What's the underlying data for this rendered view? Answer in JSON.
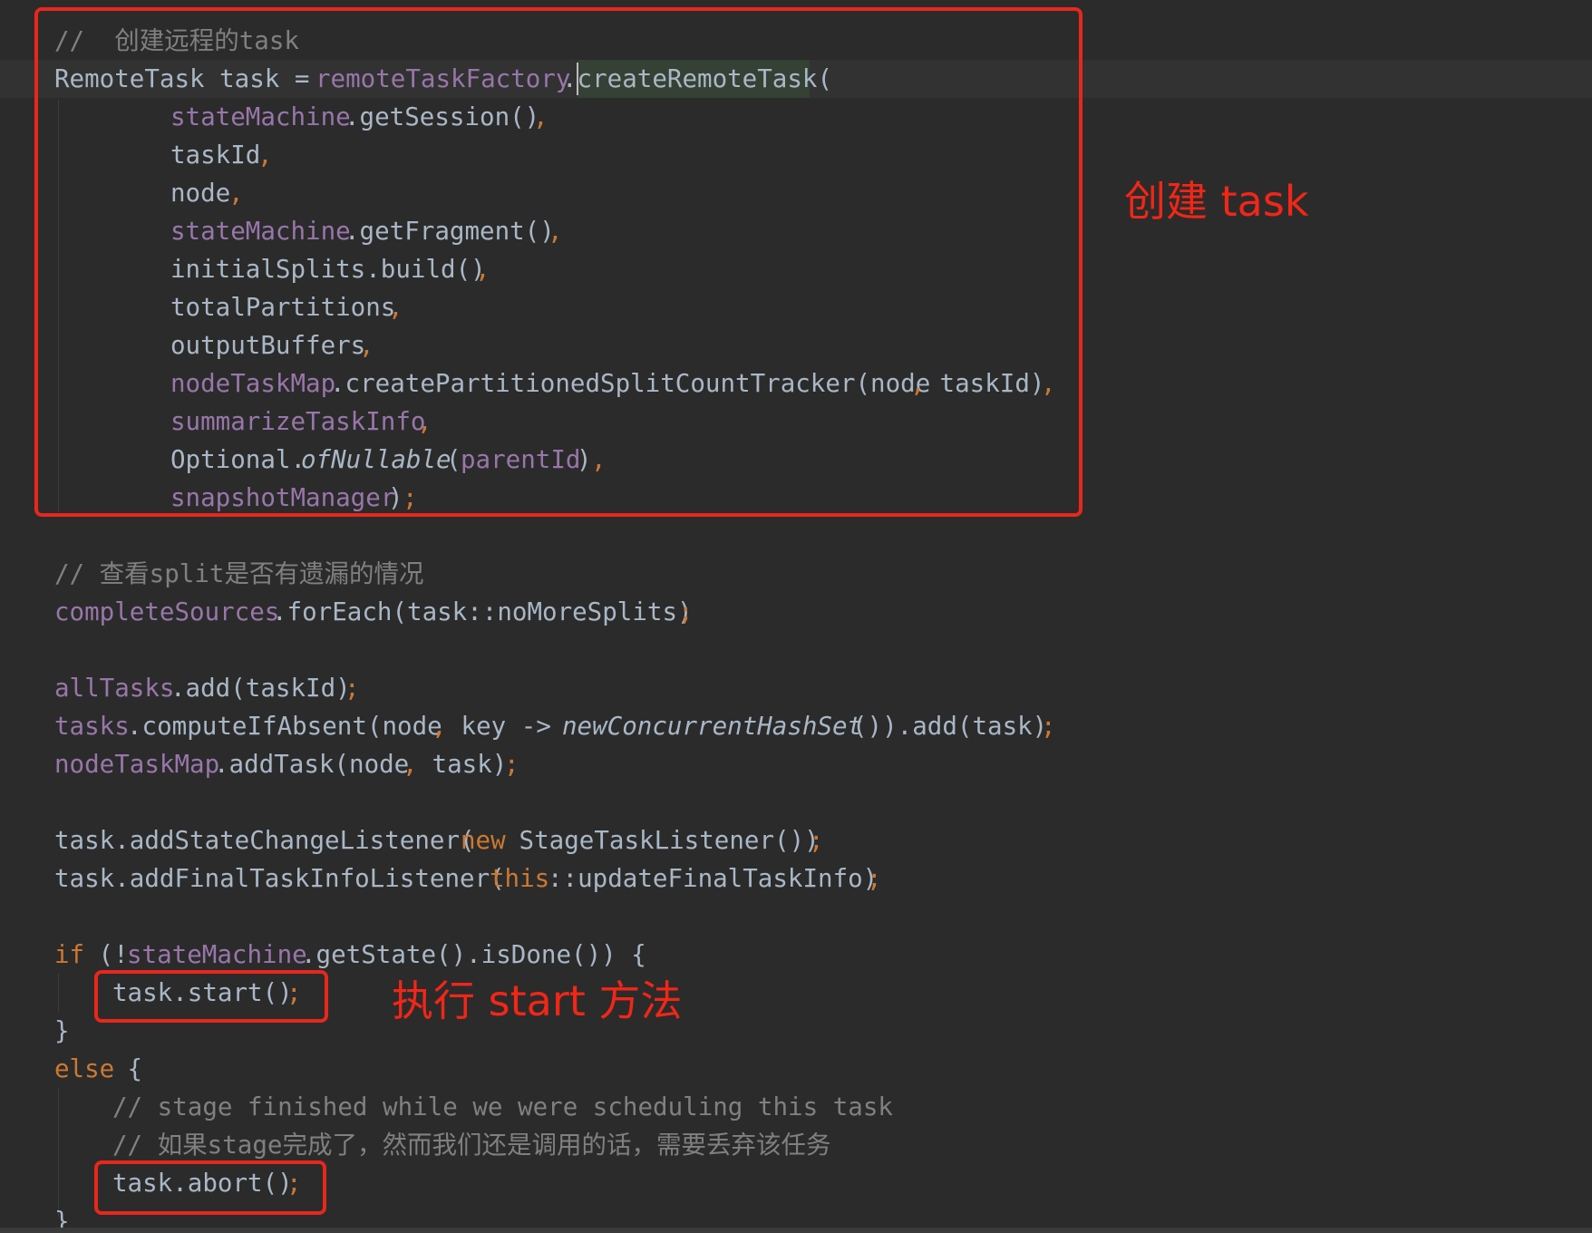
{
  "editor": {
    "theme_colors": {
      "background": "#2b2b2b",
      "default_text": "#a9b7c6",
      "field": "#9876aa",
      "keyword": "#cc7832",
      "comment": "#808080",
      "annotation_red": "#e8271c"
    },
    "lines": [
      {
        "segments": [
          "//  创建远程的task"
        ]
      },
      {
        "segments": [
          "RemoteTask task = ",
          "remoteTaskFactory",
          ".createRemoteTask("
        ]
      },
      {
        "segments": [
          "stateMachine",
          ".getSession()",
          ","
        ]
      },
      {
        "segments": [
          "taskId",
          ","
        ]
      },
      {
        "segments": [
          "node",
          ","
        ]
      },
      {
        "segments": [
          "stateMachine",
          ".getFragment()",
          ","
        ]
      },
      {
        "segments": [
          "initialSplits.build()",
          ","
        ]
      },
      {
        "segments": [
          "totalPartitions",
          ","
        ]
      },
      {
        "segments": [
          "outputBuffers",
          ","
        ]
      },
      {
        "segments": [
          "nodeTaskMap",
          ".createPartitionedSplitCountTracker(node",
          ",",
          " taskId)",
          ","
        ]
      },
      {
        "segments": [
          "summarizeTaskInfo",
          ","
        ]
      },
      {
        "segments": [
          "Optional.",
          "ofNullable",
          "(",
          "parentId",
          ")",
          ","
        ]
      },
      {
        "segments": [
          "snapshotManager",
          ")",
          ";"
        ]
      },
      {
        "segments": [
          "// 查看split是否有遗漏的情况"
        ]
      },
      {
        "segments": [
          "completeSources",
          ".forEach(task::noMoreSplits)",
          ";"
        ]
      },
      {
        "segments": [
          "allTasks",
          ".add(taskId)",
          ";"
        ]
      },
      {
        "segments": [
          "tasks",
          ".computeIfAbsent(node",
          ",",
          " key -> ",
          "newConcurrentHashSet",
          "()).add(task)",
          ";"
        ]
      },
      {
        "segments": [
          "nodeTaskMap",
          ".addTask(node",
          ",",
          " task)",
          ";"
        ]
      },
      {
        "segments": [
          "task.addStateChangeListener(",
          "new",
          " StageTaskListener())",
          ";"
        ]
      },
      {
        "segments": [
          "task.addFinalTaskInfoListener(",
          "this",
          "::updateFinalTaskInfo)",
          ";"
        ]
      },
      {
        "segments": [
          "if",
          " (!",
          "stateMachine",
          ".getState().isDone()) {"
        ]
      },
      {
        "segments": [
          "task.start()",
          ";"
        ]
      },
      {
        "segments": [
          "}"
        ]
      },
      {
        "segments": [
          "else",
          " {"
        ]
      },
      {
        "segments": [
          "// stage finished while we were scheduling this task"
        ]
      },
      {
        "segments": [
          "// 如果stage完成了，然而我们还是调用的话，需要丢弃该任务"
        ]
      },
      {
        "segments": [
          "task.abort()",
          ";"
        ]
      },
      {
        "segments": [
          "}"
        ]
      }
    ]
  },
  "annotations": {
    "create_task_label": "创建 task",
    "start_label": "执行 start 方法"
  }
}
